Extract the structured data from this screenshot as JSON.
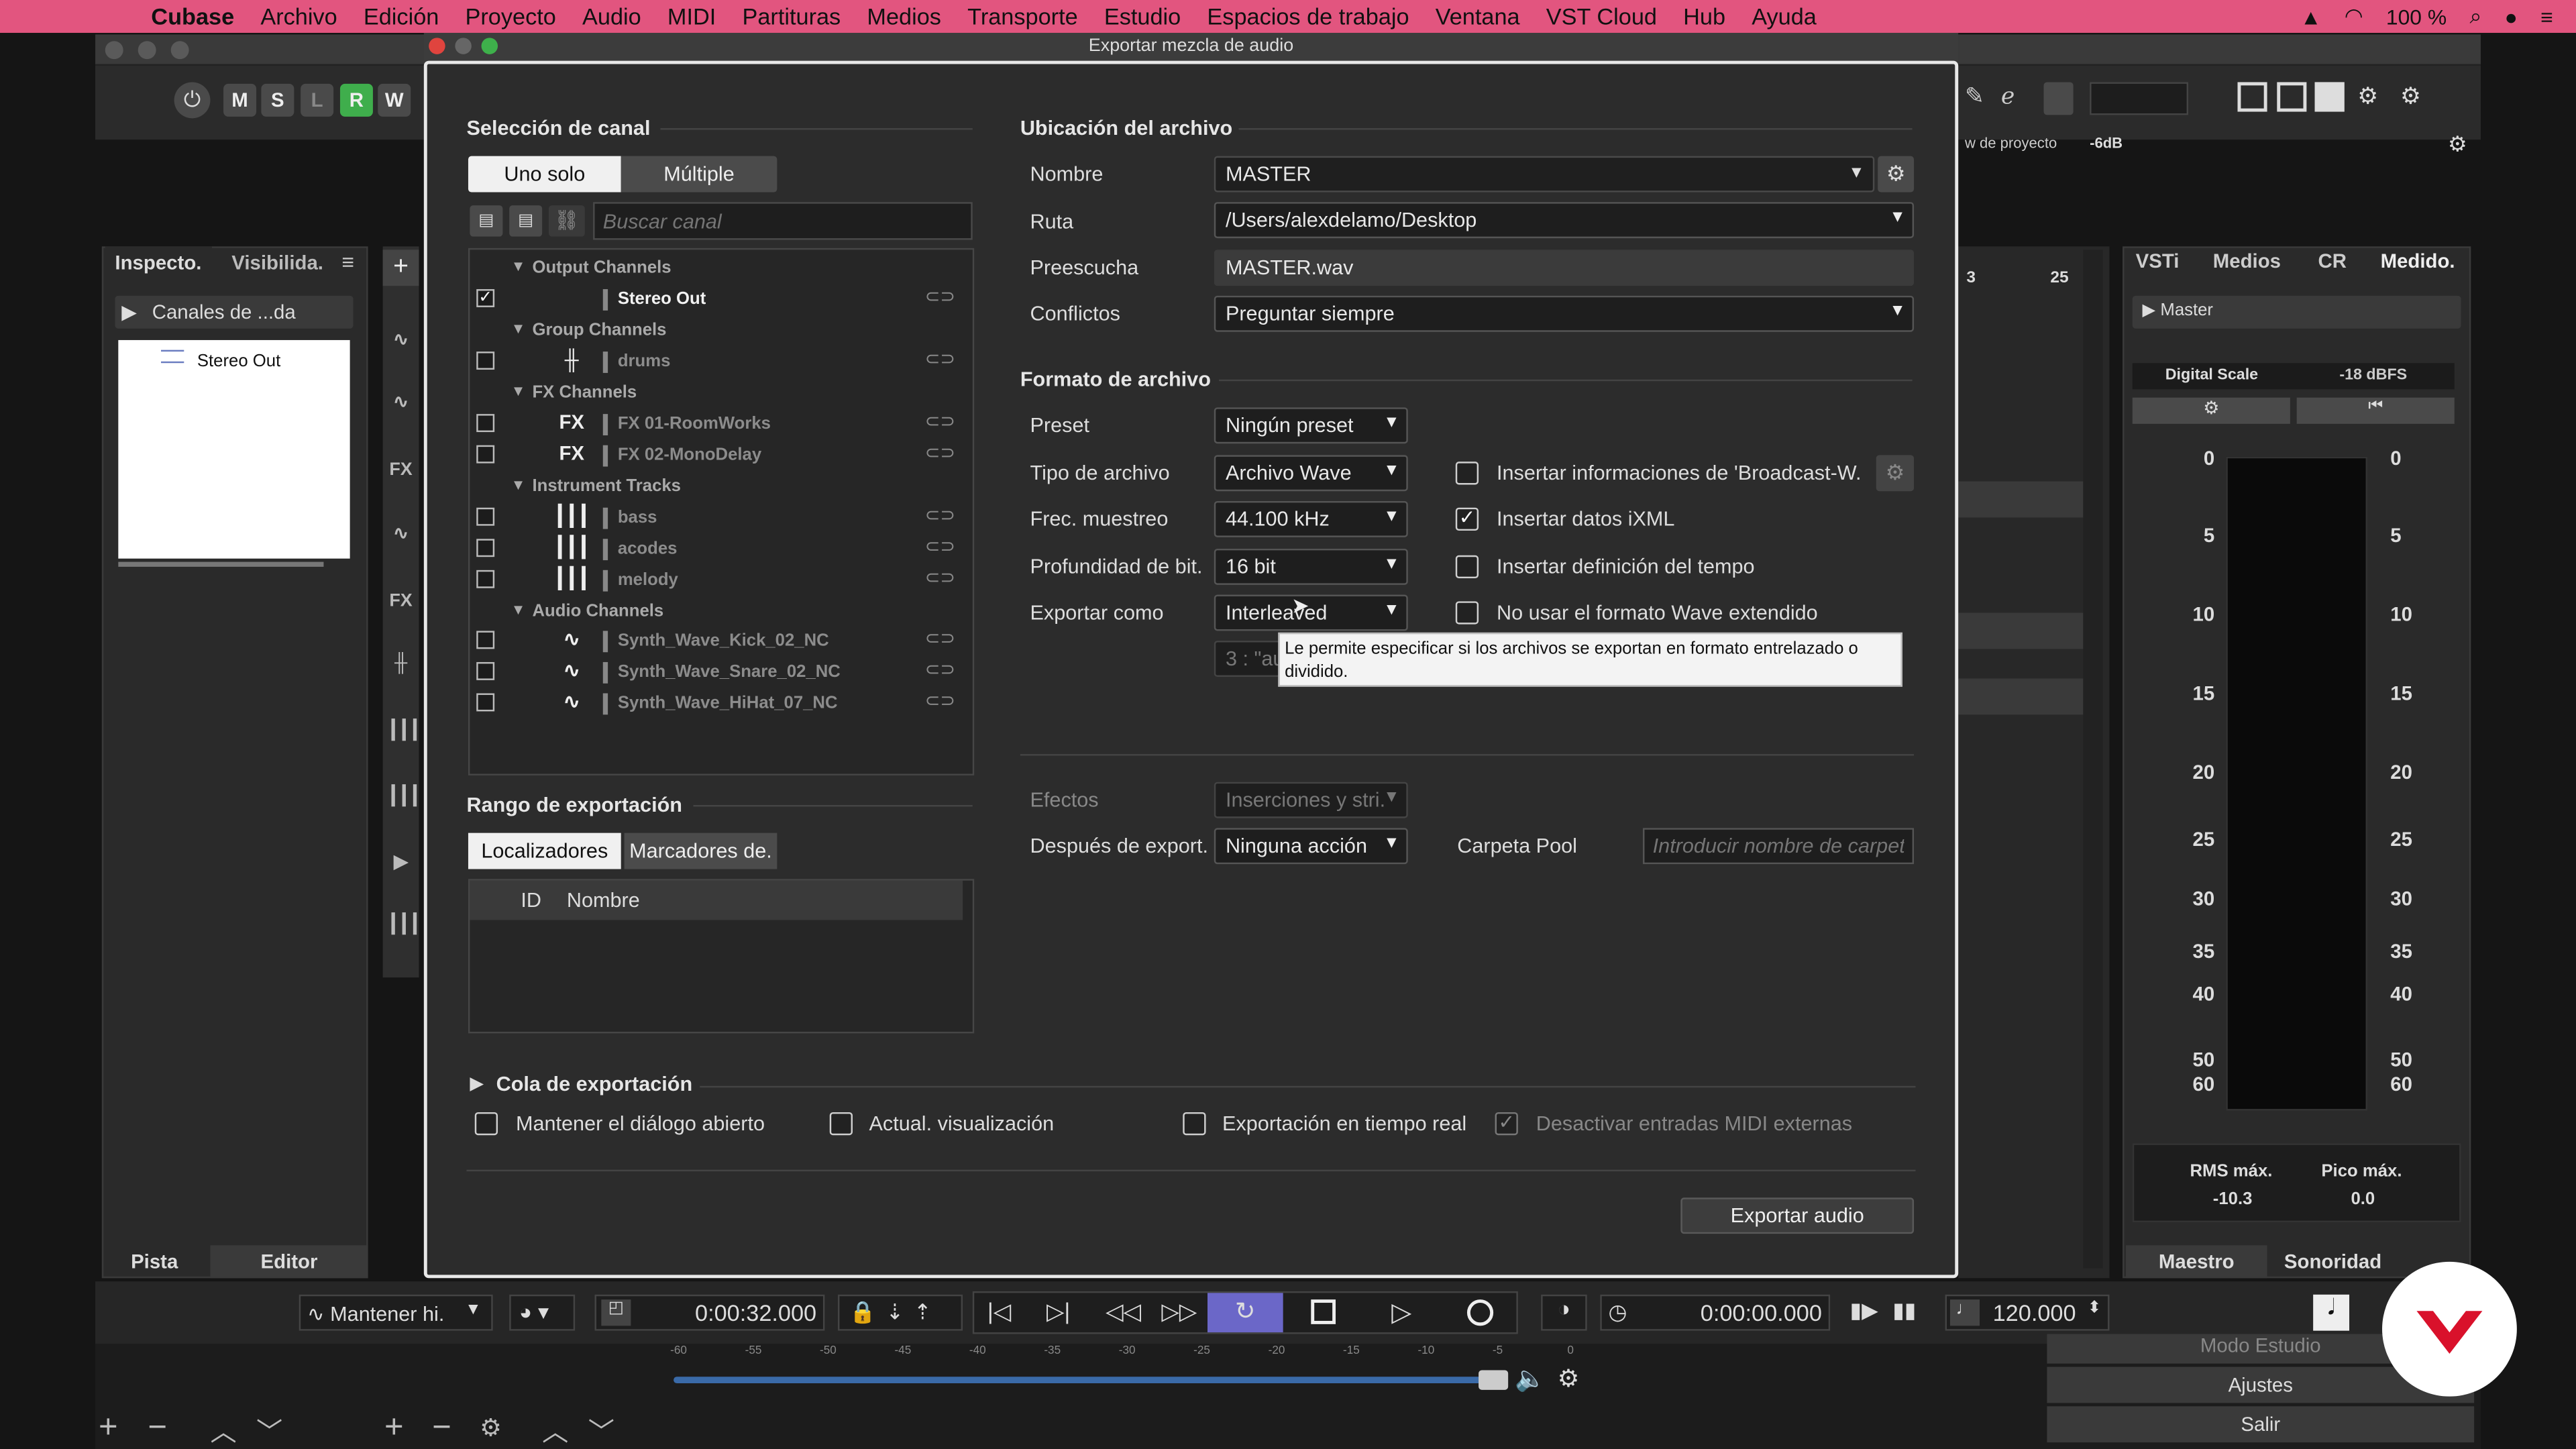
{
  "menubar": {
    "apple": "",
    "app": "Cubase",
    "items": [
      "Archivo",
      "Edición",
      "Proyecto",
      "Audio",
      "MIDI",
      "Partituras",
      "Medios",
      "Transporte",
      "Estudio",
      "Espacios de trabajo",
      "Ventana",
      "VST Cloud",
      "Hub",
      "Ayuda"
    ],
    "battery": "100 %"
  },
  "project": {
    "toolbar_buttons": [
      "M",
      "S",
      "L",
      "R",
      "W"
    ],
    "level_label": "w de proyecto",
    "level_value": "-6dB",
    "inspector_tabs": [
      "Inspecto.",
      "Visibilida."
    ],
    "inspector_folder": "Canales de ...da",
    "inspector_item": "Stereo Out",
    "inspector_bottom_tabs": [
      "Pista",
      "Editor"
    ],
    "ruler": [
      "3",
      "25"
    ],
    "rack_tabs": [
      "VSTi",
      "Medios",
      "CR",
      "Medido."
    ],
    "mixer_channel": "Master",
    "meter_scale_label": "Digital Scale",
    "meter_scale_value": "-18 dBFS",
    "meter_ticks": [
      "0",
      "5",
      "10",
      "15",
      "20",
      "25",
      "30",
      "35",
      "40",
      "50",
      "60"
    ],
    "rms_label": "RMS máx.",
    "rms_value": "-10.3",
    "peak_label": "Pico máx.",
    "peak_value": "0.0",
    "mixer_bottom_tabs": [
      "Maestro",
      "Sonoridad"
    ],
    "transport": {
      "mode": "Mantener hi.",
      "position": "0:00:32.000",
      "secondary_time": "0:00:00.000",
      "tempo": "120.000"
    },
    "hub_menu": [
      "Modo Estudio",
      "Ajustes",
      "Salir"
    ],
    "bottom_scale": [
      "-60",
      "-55",
      "-50",
      "-45",
      "-40",
      "-35",
      "-30",
      "-25",
      "-20",
      "-15",
      "-10",
      "-5",
      "0"
    ]
  },
  "dialog": {
    "title": "Exportar mezcla de audio",
    "channel_section": "Selección de canal",
    "mode_tabs": [
      "Uno solo",
      "Múltiple"
    ],
    "search_placeholder": "Buscar canal",
    "tree": {
      "groups": [
        "Output Channels",
        "Group Channels",
        "FX Channels",
        "Instrument Tracks",
        "Audio Channels"
      ],
      "items": [
        {
          "name": "Stereo Out",
          "checked": true,
          "icon": ""
        },
        {
          "name": "drums",
          "checked": false,
          "icon": "group-icon"
        },
        {
          "name": "FX 01-RoomWorks",
          "checked": false,
          "icon": "FX"
        },
        {
          "name": "FX 02-MonoDelay",
          "checked": false,
          "icon": "FX"
        },
        {
          "name": "bass",
          "checked": false,
          "icon": "keys-icon"
        },
        {
          "name": "acodes",
          "checked": false,
          "icon": "keys-icon"
        },
        {
          "name": "melody",
          "checked": false,
          "icon": "keys-icon"
        },
        {
          "name": "Synth_Wave_Kick_02_NC",
          "checked": false,
          "icon": "wave-icon"
        },
        {
          "name": "Synth_Wave_Snare_02_NC",
          "checked": false,
          "icon": "wave-icon"
        },
        {
          "name": "Synth_Wave_HiHat_07_NC",
          "checked": false,
          "icon": "wave-icon"
        }
      ]
    },
    "range_section": "Rango de exportación",
    "range_tabs": [
      "Localizadores",
      "Marcadores de."
    ],
    "range_columns": [
      "ID",
      "Nombre"
    ],
    "file_location": {
      "section": "Ubicación del archivo",
      "name_label": "Nombre",
      "name_value": "MASTER",
      "path_label": "Ruta",
      "path_value": "/Users/alexdelamo/Desktop",
      "preview_label": "Preescucha",
      "preview_value": "MASTER.wav",
      "conflicts_label": "Conflictos",
      "conflicts_value": "Preguntar siempre"
    },
    "file_format": {
      "section": "Formato de archivo",
      "preset_label": "Preset",
      "preset_value": "Ningún preset",
      "type_label": "Tipo de archivo",
      "type_value": "Archivo Wave",
      "rate_label": "Frec. muestreo",
      "rate_value": "44.100 kHz",
      "depth_label": "Profundidad de bit.",
      "depth_value": "16 bit",
      "export_as_label": "Exportar como",
      "export_as_value": "Interleaved",
      "split_value": "3 : \"au",
      "opt_broadcast": "Insertar informaciones de 'Broadcast-W.",
      "opt_ixml": "Insertar datos iXML",
      "opt_tempo": "Insertar definición del tempo",
      "opt_nowave": "No usar el formato Wave extendido",
      "tooltip": "Le permite especificar si los archivos se exportan en formato entrelazado o dividido."
    },
    "effects_label": "Efectos",
    "effects_value": "Inserciones y stri.",
    "after_label": "Después de export.",
    "after_value": "Ninguna acción",
    "pool_label": "Carpeta Pool",
    "pool_placeholder": "Introducir nombre de carpet.",
    "queue_label": "Cola de exportación",
    "bottom_opts": [
      "Mantener el diálogo abierto",
      "Actual. visualización",
      "Exportación en tiempo real",
      "Desactivar entradas MIDI externas"
    ],
    "export_button": "Exportar audio"
  }
}
